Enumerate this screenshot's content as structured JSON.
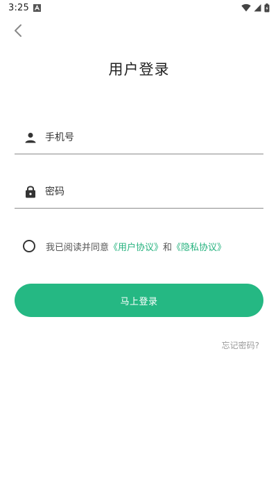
{
  "status_bar": {
    "time": "3:25"
  },
  "header": {
    "title": "用户登录"
  },
  "form": {
    "phone": {
      "placeholder": "手机号",
      "value": ""
    },
    "password": {
      "placeholder": "密码",
      "value": ""
    }
  },
  "agreement": {
    "prefix": "我已阅读并同意",
    "user_agreement": "《用户协议》",
    "conjunction": "和",
    "privacy_agreement": "《隐私协议》",
    "checked": false
  },
  "actions": {
    "login_label": "马上登录",
    "forgot_label": "忘记密码?"
  },
  "colors": {
    "accent": "#25b883",
    "link": "#25b27e",
    "muted": "#999999"
  },
  "icons": {
    "back": "chevron-left-icon",
    "phone": "person-icon",
    "password": "lock-icon",
    "wifi": "wifi-icon",
    "signal": "signal-icon",
    "battery": "battery-icon"
  }
}
